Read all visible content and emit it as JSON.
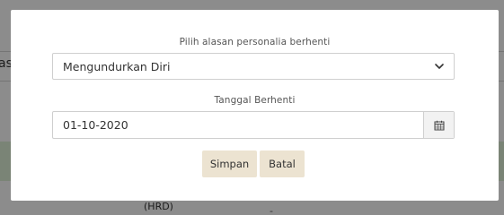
{
  "background": {
    "partial_text_left": "as",
    "partial_text_bottom": "(HRD)",
    "partial_text_dot": "-"
  },
  "modal": {
    "reason_label": "Pilih alasan personalia berhenti",
    "reason_selected": "Mengundurkan Diri",
    "date_label": "Tanggal Berhenti",
    "date_value": "01-10-2020",
    "save_label": "Simpan",
    "cancel_label": "Batal"
  },
  "icons": {
    "select_arrow": "chevron-down-icon",
    "date_picker": "calendar-icon"
  },
  "colors": {
    "button_bg": "#ece3d1",
    "overlay": "rgba(0,0,0,0.45)",
    "success_band": "#dff0d8"
  }
}
